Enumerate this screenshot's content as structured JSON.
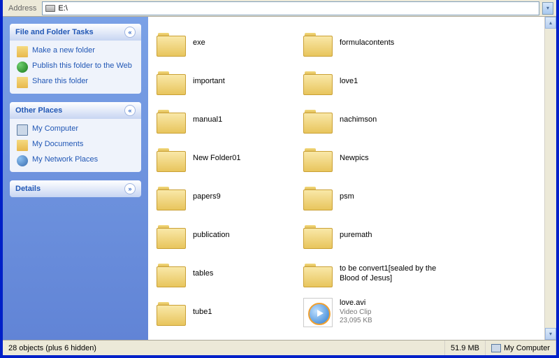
{
  "addressbar": {
    "label": "Address",
    "path": "E:\\"
  },
  "sidepanels": {
    "tasks": {
      "title": "File and Folder Tasks",
      "items": [
        {
          "label": "Make a new folder",
          "icon": "folder"
        },
        {
          "label": "Publish this folder to the Web",
          "icon": "globe"
        },
        {
          "label": "Share this folder",
          "icon": "share"
        }
      ]
    },
    "places": {
      "title": "Other Places",
      "items": [
        {
          "label": "My Computer",
          "icon": "comp"
        },
        {
          "label": "My Documents",
          "icon": "docs"
        },
        {
          "label": "My Network Places",
          "icon": "net"
        }
      ]
    },
    "details": {
      "title": "Details"
    }
  },
  "items": [
    {
      "name": "exe",
      "type": "folder"
    },
    {
      "name": "formulacontents",
      "type": "folder"
    },
    {
      "name": "important",
      "type": "folder"
    },
    {
      "name": "love1",
      "type": "folder"
    },
    {
      "name": "manual1",
      "type": "folder"
    },
    {
      "name": "nachimson",
      "type": "folder"
    },
    {
      "name": "New Folder01",
      "type": "folder"
    },
    {
      "name": "Newpics",
      "type": "folder"
    },
    {
      "name": "papers9",
      "type": "folder"
    },
    {
      "name": "psm",
      "type": "folder"
    },
    {
      "name": "publication",
      "type": "folder"
    },
    {
      "name": "puremath",
      "type": "folder"
    },
    {
      "name": "tables",
      "type": "folder"
    },
    {
      "name": "to be convert1[sealed by the Blood of Jesus]",
      "type": "folder"
    },
    {
      "name": "tube1",
      "type": "folder"
    },
    {
      "name": "love.avi",
      "type": "video",
      "kind": "Video Clip",
      "size": "23,095 KB"
    }
  ],
  "statusbar": {
    "objects": "28 objects (plus 6 hidden)",
    "size": "51.9 MB",
    "location": "My Computer"
  }
}
